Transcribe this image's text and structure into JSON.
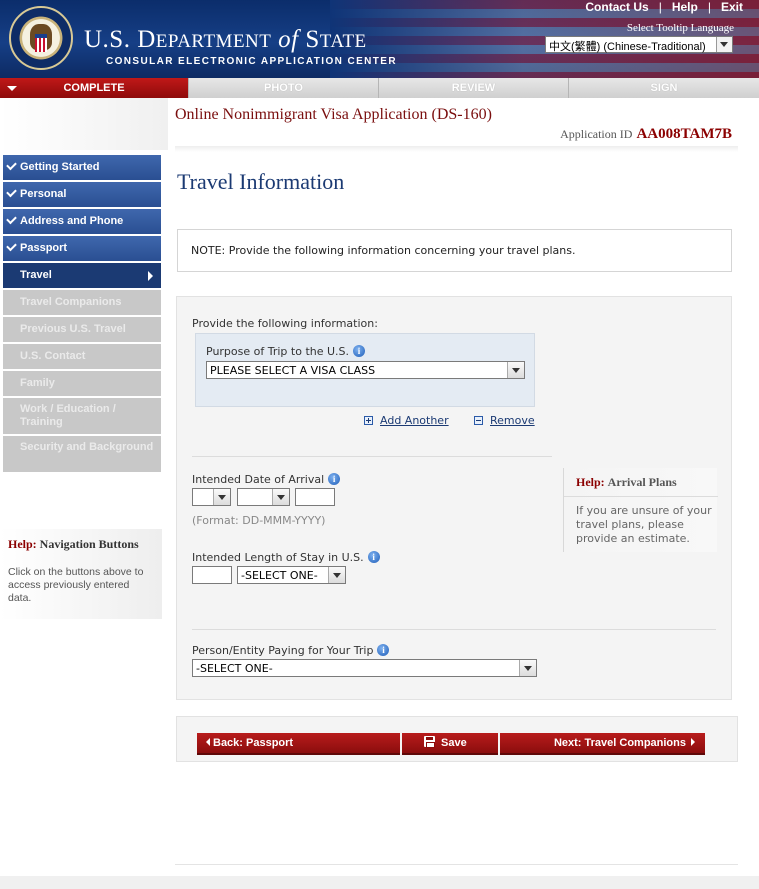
{
  "header": {
    "links": [
      "Contact Us",
      "Help",
      "Exit"
    ],
    "title_prefix": "U.S. D",
    "title_dept": "EPARTMENT",
    "title_of": "of",
    "title_state": "S",
    "title_state_rest": "TATE",
    "subtitle": "CONSULAR ELECTRONIC APPLICATION CENTER",
    "tooltip_label": "Select Tooltip Language",
    "language_selected": "中文(繁體)  (Chinese-Traditional)"
  },
  "progress": {
    "steps": [
      "COMPLETE",
      "PHOTO",
      "REVIEW",
      "SIGN"
    ],
    "active": "COMPLETE"
  },
  "sidebar": {
    "items": [
      {
        "label": "Getting Started",
        "state": "done"
      },
      {
        "label": "Personal",
        "state": "done"
      },
      {
        "label": "Address and Phone",
        "state": "done"
      },
      {
        "label": "Passport",
        "state": "done"
      },
      {
        "label": "Travel",
        "state": "current"
      },
      {
        "label": "Travel Companions",
        "state": "future"
      },
      {
        "label": "Previous U.S. Travel",
        "state": "future"
      },
      {
        "label": "U.S. Contact",
        "state": "future"
      },
      {
        "label": "Family",
        "state": "future"
      },
      {
        "label": "Work / Education / Training",
        "state": "future"
      },
      {
        "label": "Security and Background",
        "state": "future"
      }
    ],
    "help_prefix": "Help:",
    "help_title": "Navigation Buttons",
    "help_text": "Click on the buttons above to access previously entered data."
  },
  "main": {
    "app_title": "Online Nonimmigrant Visa Application (DS-160)",
    "app_id_label": "Application ID",
    "app_id": "AA008TAM7B",
    "page_title": "Travel Information",
    "note": "NOTE: Provide the following information concerning your travel plans."
  },
  "form": {
    "intro": "Provide the following information:",
    "purpose_label": "Purpose of Trip to the U.S.",
    "purpose_value": "PLEASE SELECT A VISA CLASS",
    "add_another": "Add Another",
    "remove": "Remove",
    "arrival_label": "Intended Date of Arrival",
    "arrival_format": "(Format: DD-MMM-YYYY)",
    "stay_label": "Intended Length of Stay in U.S.",
    "stay_unit": "-SELECT ONE-",
    "payer_label": "Person/Entity Paying for Your Trip",
    "payer_value": "-SELECT ONE-",
    "help_prefix": "Help:",
    "help_title": "Arrival Plans",
    "help_text": "If you are unsure of your travel plans, please provide an estimate.",
    "info_glyph": "i"
  },
  "buttons": {
    "back": "Back: Passport",
    "save": "Save",
    "next": "Next: Travel Companions"
  },
  "icons": {
    "seal": "department-of-state-seal",
    "info": "info-icon",
    "add": "plus-square-icon",
    "remove": "minus-square-icon",
    "save": "floppy-disk-icon"
  },
  "colors": {
    "nav_done": "#2a4f92",
    "nav_current": "#1b3a73",
    "button_red": "#8b0d0d",
    "title_red": "#7a0e0e"
  }
}
